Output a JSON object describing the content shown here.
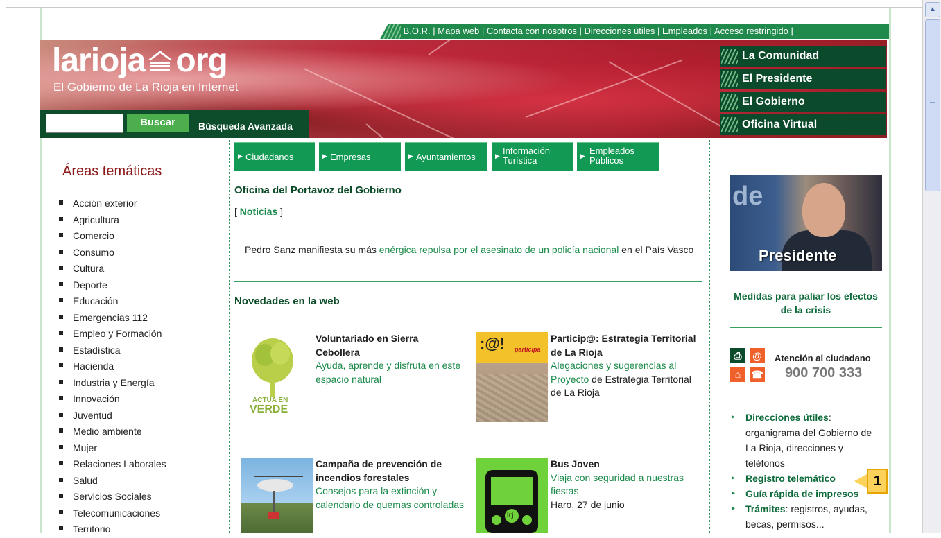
{
  "top_links": [
    "B.O.R.",
    "Mapa web",
    "Contacta con nosotros",
    "Direcciones útiles",
    "Empleados",
    "Acceso restringido"
  ],
  "header": {
    "logo": "larioja",
    "logo_suffix": "org",
    "tagline": "El Gobierno de La Rioja en Internet",
    "search_button": "Buscar",
    "advanced_search": "Búsqueda Avanzada"
  },
  "right_nav": [
    "La Comunidad",
    "El Presidente",
    "El Gobierno",
    "Oficina Virtual"
  ],
  "left": {
    "title": "Áreas temáticas",
    "items": [
      "Acción exterior",
      "Agricultura",
      "Comercio",
      "Consumo",
      "Cultura",
      "Deporte",
      "Educación",
      "Emergencias 112",
      "Empleo y Formación",
      "Estadística",
      "Hacienda",
      "Industria y Energía",
      "Innovación",
      "Juventud",
      "Medio ambiente",
      "Mujer",
      "Relaciones Laborales",
      "Salud",
      "Servicios Sociales",
      "Telecomunicaciones",
      "Territorio"
    ]
  },
  "tabs": [
    {
      "l1": "Ciudadanos",
      "l2": ""
    },
    {
      "l1": "Empresas",
      "l2": ""
    },
    {
      "l1": "Ayuntamientos",
      "l2": ""
    },
    {
      "l1": "Información",
      "l2": "Turística"
    },
    {
      "l1": "Empleados",
      "l2": "Públicos"
    }
  ],
  "center": {
    "portavoz_title": "Oficina del Portavoz del Gobierno",
    "noticias": "Noticias",
    "news_pre": "Pedro Sanz manifiesta su más ",
    "news_link": "enérgica repulsa por el asesinato de un policía nacional",
    "news_post": " en el País Vasco",
    "novedades_title": "Novedades en la web",
    "items": [
      {
        "title": "Voluntariado en Sierra Cebollera",
        "link": "Ayuda, aprende y disfruta en este espacio natural",
        "extra": ""
      },
      {
        "title": "Particip@: Estrategia Territorial de La Rioja",
        "link": "Alegaciones y sugerencias al Proyecto",
        "extra": " de Estrategia Territorial de La Rioja"
      },
      {
        "title": "Campaña de prevención de incendios forestales",
        "link": "Consejos para la extinción y calendario de quemas controladas",
        "extra": ""
      },
      {
        "title": "Bus Joven",
        "link": "Viaja con seguridad a nuestras fiestas",
        "extra": "Haro, 27 de junio"
      }
    ],
    "img_actuaen": "ACTUA EN",
    "img_verde": "VERDE",
    "img_participa": ":@!",
    "img_participa_small": "participa",
    "img_bus": "lrj"
  },
  "right": {
    "presidente_label": "Presidente",
    "pres_logo": "de",
    "medidas": "Medidas para paliar los efectos de la crisis",
    "atencion": "Atención al ciudadano",
    "phone": "900 700 333",
    "links": [
      {
        "link": "Direcciones útiles",
        "text": ": organigrama del Gobierno de La Rioja, direcciones y teléfonos"
      },
      {
        "link": "Registro telemático",
        "text": ""
      },
      {
        "link": "Guía rápida de impresos",
        "text": ""
      },
      {
        "link": "Trámites",
        "text": ": registros, ayudas, becas, permisos..."
      }
    ]
  },
  "callout_number": "1"
}
